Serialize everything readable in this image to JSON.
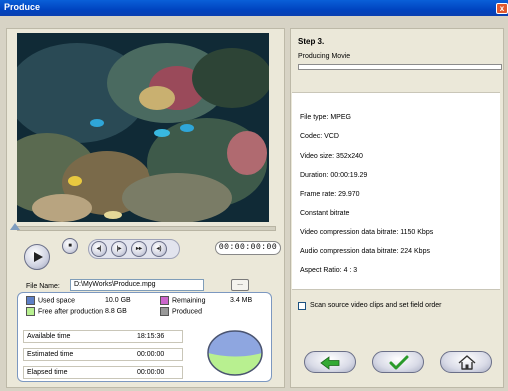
{
  "window": {
    "title": "Produce",
    "close_glyph": "x"
  },
  "player": {
    "timecode": "00:00:00:00",
    "buttons": [
      "play-icon",
      "stop-icon",
      "prev-frame-icon",
      "next-frame-icon",
      "fast-forward-icon",
      "volume-icon"
    ]
  },
  "file": {
    "label": "File Name:",
    "value": "D:\\MyWorks\\Produce.mpg",
    "browse_label": "..."
  },
  "disk": {
    "used_label": "Used space",
    "used_value": "10.0  GB",
    "free_label": "Free after production",
    "free_value": "8.8  GB",
    "remaining_label": "Remaining",
    "remaining_value": "3.4  MB",
    "produced_label": "Produced",
    "colors": {
      "used": "#5d7fc6",
      "free": "#b8f090",
      "remaining": "#cc66cc",
      "produced": "#999999"
    }
  },
  "times": [
    {
      "label": "Available time",
      "value": "18:15:36"
    },
    {
      "label": "Estimated time",
      "value": "00:00:00"
    },
    {
      "label": "Elapsed time",
      "value": "00:00:00"
    }
  ],
  "step": {
    "title": "Step 3.",
    "status": "Producing Movie",
    "progress": 0
  },
  "info": [
    "File type: MPEG",
    "Codec: VCD",
    "Video size: 352x240",
    "Duration: 00:00:19.29",
    "Frame rate: 29.970",
    "Constant bitrate",
    "Video compression data bitrate: 1150 Kbps",
    "Audio compression data bitrate: 224 Kbps",
    "Aspect Ratio: 4 : 3"
  ],
  "option": {
    "label": "Scan source video clips and set field order",
    "checked": false
  },
  "nav": {
    "buttons": [
      "back-arrow-icon",
      "checkmark-icon",
      "home-icon"
    ]
  }
}
